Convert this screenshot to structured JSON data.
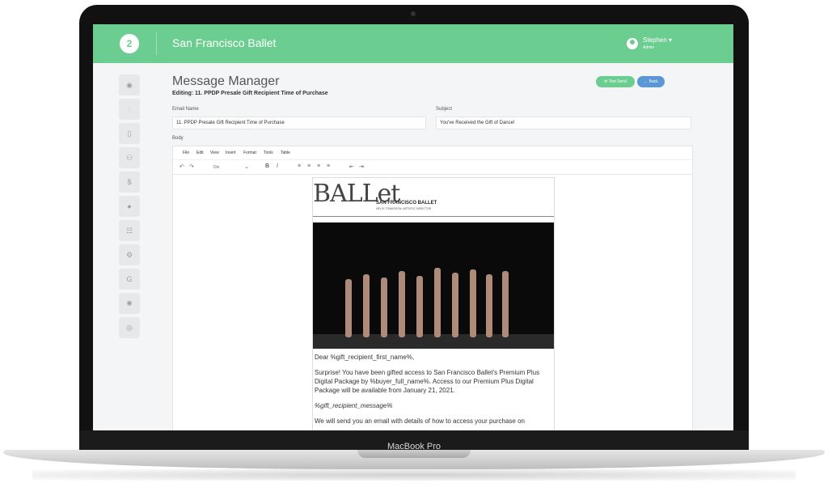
{
  "device": {
    "label": "MacBook Pro"
  },
  "header": {
    "logo_text": "2",
    "app_title": "San Francisco Ballet",
    "user_name": "Stephen ▾",
    "user_role": "Admin"
  },
  "sidebar": {
    "items": [
      {
        "icon": "dashboard-icon",
        "glyph": "◉"
      },
      {
        "icon": "chart-icon",
        "glyph": "⫶"
      },
      {
        "icon": "mobile-icon",
        "glyph": "▯"
      },
      {
        "icon": "users-icon",
        "glyph": "⚇"
      },
      {
        "icon": "dollar-icon",
        "glyph": "$"
      },
      {
        "icon": "info-icon",
        "glyph": "●"
      },
      {
        "icon": "report-icon",
        "glyph": "☷"
      },
      {
        "icon": "settings-icon",
        "glyph": "⚙"
      },
      {
        "icon": "g-icon",
        "glyph": "G"
      },
      {
        "icon": "gear-icon",
        "glyph": "✺"
      },
      {
        "icon": "user-circle-icon",
        "glyph": "◎"
      }
    ]
  },
  "page": {
    "title": "Message Manager",
    "subtitle": "Editing: 11. PPDP Presale Gift Recipient Time of Purchase",
    "buttons": {
      "test_send": "✉ Test Send",
      "back": "← Back"
    }
  },
  "form": {
    "email_name_label": "Email Name",
    "email_name_value": "11. PPDP Presale Gift Recipient Time of Purchase",
    "subject_label": "Subject",
    "subject_value": "You've Received the Gift of Dance!",
    "body_label": "Body"
  },
  "editor": {
    "menu": [
      "File",
      "Edit",
      "View",
      "Insert",
      "Format",
      "Tools",
      "Table"
    ],
    "toolbar": {
      "undo": "↶",
      "redo": "↷",
      "block": "Div",
      "dropdown": "⌄",
      "bold": "B",
      "italic": "I",
      "align_left": "≡",
      "align_center": "≡",
      "align_right": "≡",
      "align_justify": "≡",
      "outdent": "⇤",
      "indent": "⇥"
    }
  },
  "email": {
    "logo_text": "BALLet",
    "org_name": "SAN FRANCISCO BALLET",
    "director": "HELGI TOMASSON, ARTISTIC DIRECTOR",
    "greeting": "Dear %gift_recipient_first_name%,",
    "paragraph1": "Surprise! You have been gifted access to San Francisco Ballet's Premium Plus Digital Package by %buyer_full_name%. Access to our Premium Plus Digital Package will be available from January 21, 2021.",
    "message_tag": "%gift_recipient_message%",
    "paragraph2": "We will send you an email with details of how to access your purchase on"
  }
}
